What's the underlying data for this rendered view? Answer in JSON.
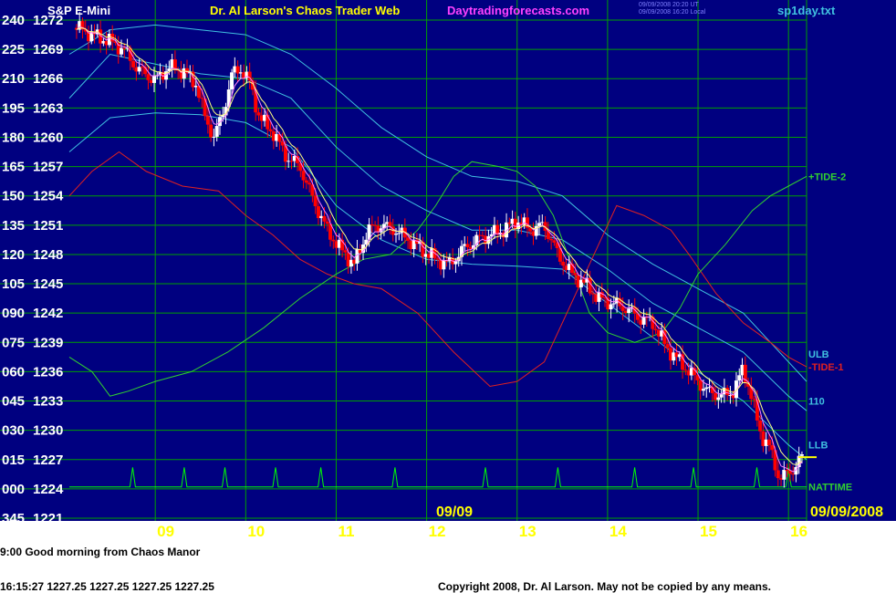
{
  "header": {
    "instrument": "S&P E-Mini",
    "title": "Dr. Al Larson's Chaos Trader Web",
    "site": "Daytradingforecasts.com",
    "stamp_line1": "09/09/2008 20:20 UT",
    "stamp_line2": "09/09/2008 16:20 Local",
    "file": "sp1day.txt"
  },
  "colors": {
    "background": "#ffffff",
    "plot": "#000080",
    "grid": "#00a000",
    "up_candle": "#ffffff",
    "down_candle": "#ff0000",
    "band": "#40c0e0",
    "tide1": "#e02020",
    "tide2": "#30d030",
    "ema_fast": "#ff80ff",
    "ema_slow": "#ffff80",
    "nattime": "#00ff00"
  },
  "footer": {
    "message": "9:00 Good morning from Chaos Manor",
    "quote": "16:15:27  1227.25 1227.25 1227.25 1227.25",
    "copyright": "Copyright 2008, Dr. Al Larson. May not be copied by any means."
  },
  "chart_data": {
    "type": "candlestick",
    "y_left_labels": [
      "240",
      "225",
      "210",
      "195",
      "180",
      "165",
      "150",
      "135",
      "120",
      "105",
      "090",
      "075",
      "060",
      "045",
      "030",
      "015",
      "000",
      "345"
    ],
    "price_ticks": [
      1272,
      1269,
      1266,
      1263,
      1260,
      1257,
      1254,
      1251,
      1248,
      1245,
      1242,
      1239,
      1236,
      1233,
      1230,
      1227,
      1224,
      1221
    ],
    "ylim": [
      1221,
      1272
    ],
    "x_ticks": [
      {
        "hour": 9,
        "label": "09"
      },
      {
        "hour": 10,
        "label": "10"
      },
      {
        "hour": 11,
        "label": "11"
      },
      {
        "hour": 12,
        "label": "12"
      },
      {
        "hour": 13,
        "label": "13"
      },
      {
        "hour": 14,
        "label": "14"
      },
      {
        "hour": 15,
        "label": "15"
      },
      {
        "hour": 16,
        "label": "16"
      }
    ],
    "xlim": [
      8.05,
      16.2
    ],
    "date_mid": "09/09",
    "date_right": "09/09/2008",
    "series": {
      "close": [
        [
          8.15,
          1271.2
        ],
        [
          8.3,
          1270.5
        ],
        [
          8.5,
          1269.8
        ],
        [
          8.65,
          1269.0
        ],
        [
          8.8,
          1267.0
        ],
        [
          9.0,
          1265.8
        ],
        [
          9.15,
          1267.2
        ],
        [
          9.3,
          1266.8
        ],
        [
          9.45,
          1265.5
        ],
        [
          9.55,
          1262.0
        ],
        [
          9.65,
          1260.0
        ],
        [
          9.75,
          1262.5
        ],
        [
          9.85,
          1266.5
        ],
        [
          9.95,
          1267.0
        ],
        [
          10.05,
          1265.5
        ],
        [
          10.15,
          1262.0
        ],
        [
          10.3,
          1260.5
        ],
        [
          10.45,
          1258.0
        ],
        [
          10.6,
          1257.0
        ],
        [
          10.75,
          1253.5
        ],
        [
          10.9,
          1250.5
        ],
        [
          11.05,
          1248.5
        ],
        [
          11.2,
          1247.0
        ],
        [
          11.35,
          1250.5
        ],
        [
          11.5,
          1251.0
        ],
        [
          11.65,
          1250.5
        ],
        [
          11.8,
          1249.5
        ],
        [
          11.95,
          1248.5
        ],
        [
          12.1,
          1247.5
        ],
        [
          12.25,
          1247.0
        ],
        [
          12.4,
          1248.5
        ],
        [
          12.55,
          1249.5
        ],
        [
          12.7,
          1250.0
        ],
        [
          12.85,
          1250.5
        ],
        [
          13.0,
          1251.5
        ],
        [
          13.15,
          1250.5
        ],
        [
          13.3,
          1251.0
        ],
        [
          13.45,
          1248.0
        ],
        [
          13.6,
          1246.0
        ],
        [
          13.75,
          1245.0
        ],
        [
          13.9,
          1243.5
        ],
        [
          14.05,
          1243.0
        ],
        [
          14.2,
          1242.5
        ],
        [
          14.35,
          1241.5
        ],
        [
          14.5,
          1241.0
        ],
        [
          14.65,
          1238.5
        ],
        [
          14.8,
          1237.0
        ],
        [
          14.95,
          1235.5
        ],
        [
          15.1,
          1234.0
        ],
        [
          15.25,
          1233.5
        ],
        [
          15.4,
          1234.0
        ],
        [
          15.5,
          1236.5
        ],
        [
          15.6,
          1233.0
        ],
        [
          15.7,
          1229.5
        ],
        [
          15.8,
          1228.0
        ],
        [
          15.9,
          1225.0
        ],
        [
          16.05,
          1226.0
        ],
        [
          16.15,
          1227.25
        ]
      ],
      "band_upper": [
        [
          8.05,
          1268.5
        ],
        [
          8.5,
          1271.0
        ],
        [
          9.0,
          1271.5
        ],
        [
          9.5,
          1271.0
        ],
        [
          10.0,
          1270.5
        ],
        [
          10.5,
          1268.5
        ],
        [
          11.0,
          1265.0
        ],
        [
          11.5,
          1261.0
        ],
        [
          12.0,
          1258.0
        ],
        [
          12.5,
          1256.0
        ],
        [
          13.0,
          1255.5
        ],
        [
          13.5,
          1254.0
        ],
        [
          14.0,
          1250.0
        ],
        [
          14.5,
          1247.0
        ],
        [
          15.0,
          1244.5
        ],
        [
          15.5,
          1242.0
        ],
        [
          16.0,
          1237.0
        ],
        [
          16.2,
          1235.0
        ]
      ],
      "band_mid": [
        [
          8.05,
          1264.0
        ],
        [
          8.5,
          1268.5
        ],
        [
          9.0,
          1267.5
        ],
        [
          9.5,
          1266.5
        ],
        [
          10.0,
          1266.0
        ],
        [
          10.5,
          1264.0
        ],
        [
          11.0,
          1259.0
        ],
        [
          11.5,
          1255.0
        ],
        [
          12.0,
          1252.5
        ],
        [
          12.5,
          1250.5
        ],
        [
          13.0,
          1250.5
        ],
        [
          13.5,
          1249.5
        ],
        [
          14.0,
          1246.5
        ],
        [
          14.5,
          1243.0
        ],
        [
          15.0,
          1240.5
        ],
        [
          15.5,
          1238.0
        ],
        [
          16.0,
          1233.5
        ],
        [
          16.2,
          1232.0
        ]
      ],
      "band_lower": [
        [
          8.05,
          1258.5
        ],
        [
          8.5,
          1262.0
        ],
        [
          9.0,
          1262.5
        ],
        [
          9.5,
          1262.3
        ],
        [
          10.0,
          1261.5
        ],
        [
          10.5,
          1259.0
        ],
        [
          11.0,
          1253.0
        ],
        [
          11.5,
          1249.5
        ],
        [
          12.0,
          1247.5
        ],
        [
          12.5,
          1247.0
        ],
        [
          13.0,
          1246.8
        ],
        [
          13.5,
          1246.5
        ],
        [
          14.0,
          1243.0
        ],
        [
          14.5,
          1239.5
        ],
        [
          15.0,
          1236.0
        ],
        [
          15.5,
          1233.0
        ],
        [
          16.0,
          1228.5
        ],
        [
          16.2,
          1227.0
        ]
      ],
      "tide1": [
        [
          8.05,
          1254.0
        ],
        [
          8.3,
          1256.5
        ],
        [
          8.6,
          1258.5
        ],
        [
          8.9,
          1256.5
        ],
        [
          9.3,
          1255.0
        ],
        [
          9.7,
          1254.5
        ],
        [
          10.0,
          1252.0
        ],
        [
          10.3,
          1250.0
        ],
        [
          10.6,
          1247.5
        ],
        [
          10.9,
          1246.0
        ],
        [
          11.2,
          1245.0
        ],
        [
          11.5,
          1244.5
        ],
        [
          11.9,
          1242.0
        ],
        [
          12.3,
          1238.0
        ],
        [
          12.7,
          1234.5
        ],
        [
          13.0,
          1235.0
        ],
        [
          13.3,
          1237.0
        ],
        [
          13.6,
          1243.0
        ],
        [
          13.9,
          1249.0
        ],
        [
          14.1,
          1253.0
        ],
        [
          14.4,
          1252.0
        ],
        [
          14.7,
          1250.5
        ],
        [
          14.9,
          1248.0
        ],
        [
          15.2,
          1244.0
        ],
        [
          15.5,
          1241.0
        ],
        [
          15.8,
          1239.0
        ],
        [
          16.0,
          1237.5
        ],
        [
          16.2,
          1236.5
        ]
      ],
      "tide2": [
        [
          8.05,
          1237.5
        ],
        [
          8.3,
          1236.0
        ],
        [
          8.5,
          1233.5
        ],
        [
          8.7,
          1234.0
        ],
        [
          9.0,
          1235.0
        ],
        [
          9.4,
          1236.0
        ],
        [
          9.8,
          1238.0
        ],
        [
          10.2,
          1240.5
        ],
        [
          10.6,
          1243.5
        ],
        [
          11.0,
          1246.0
        ],
        [
          11.3,
          1247.5
        ],
        [
          11.6,
          1248.0
        ],
        [
          11.9,
          1250.5
        ],
        [
          12.1,
          1253.0
        ],
        [
          12.3,
          1256.0
        ],
        [
          12.5,
          1257.5
        ],
        [
          12.8,
          1257.0
        ],
        [
          13.0,
          1256.5
        ],
        [
          13.2,
          1255.0
        ],
        [
          13.4,
          1252.0
        ],
        [
          13.6,
          1247.0
        ],
        [
          13.8,
          1242.0
        ],
        [
          14.0,
          1240.0
        ],
        [
          14.3,
          1239.0
        ],
        [
          14.6,
          1240.0
        ],
        [
          14.8,
          1242.5
        ],
        [
          15.0,
          1246.0
        ],
        [
          15.3,
          1249.0
        ],
        [
          15.6,
          1252.5
        ],
        [
          15.8,
          1254.0
        ],
        [
          16.0,
          1255.0
        ],
        [
          16.2,
          1256.0
        ]
      ],
      "nattime_peaks": [
        8.75,
        9.32,
        9.77,
        10.33,
        10.83,
        11.65,
        12.65,
        13.45,
        14.3,
        14.95,
        15.65,
        16.0
      ]
    },
    "right_labels": [
      {
        "text": "+TIDE-2",
        "y": 1256.0,
        "color": "#30d030"
      },
      {
        "text": "ULB",
        "y": 1237.8,
        "color": "#40c0e0"
      },
      {
        "text": "-TIDE-1",
        "y": 1236.5,
        "color": "#e02020"
      },
      {
        "text": "110",
        "y": 1233.0,
        "color": "#40c0e0"
      },
      {
        "text": "LLB",
        "y": 1228.5,
        "color": "#40c0e0"
      },
      {
        "text": "NATTIME",
        "y": 1224.2,
        "color": "#30d030"
      }
    ],
    "last_price": 1227.25
  }
}
